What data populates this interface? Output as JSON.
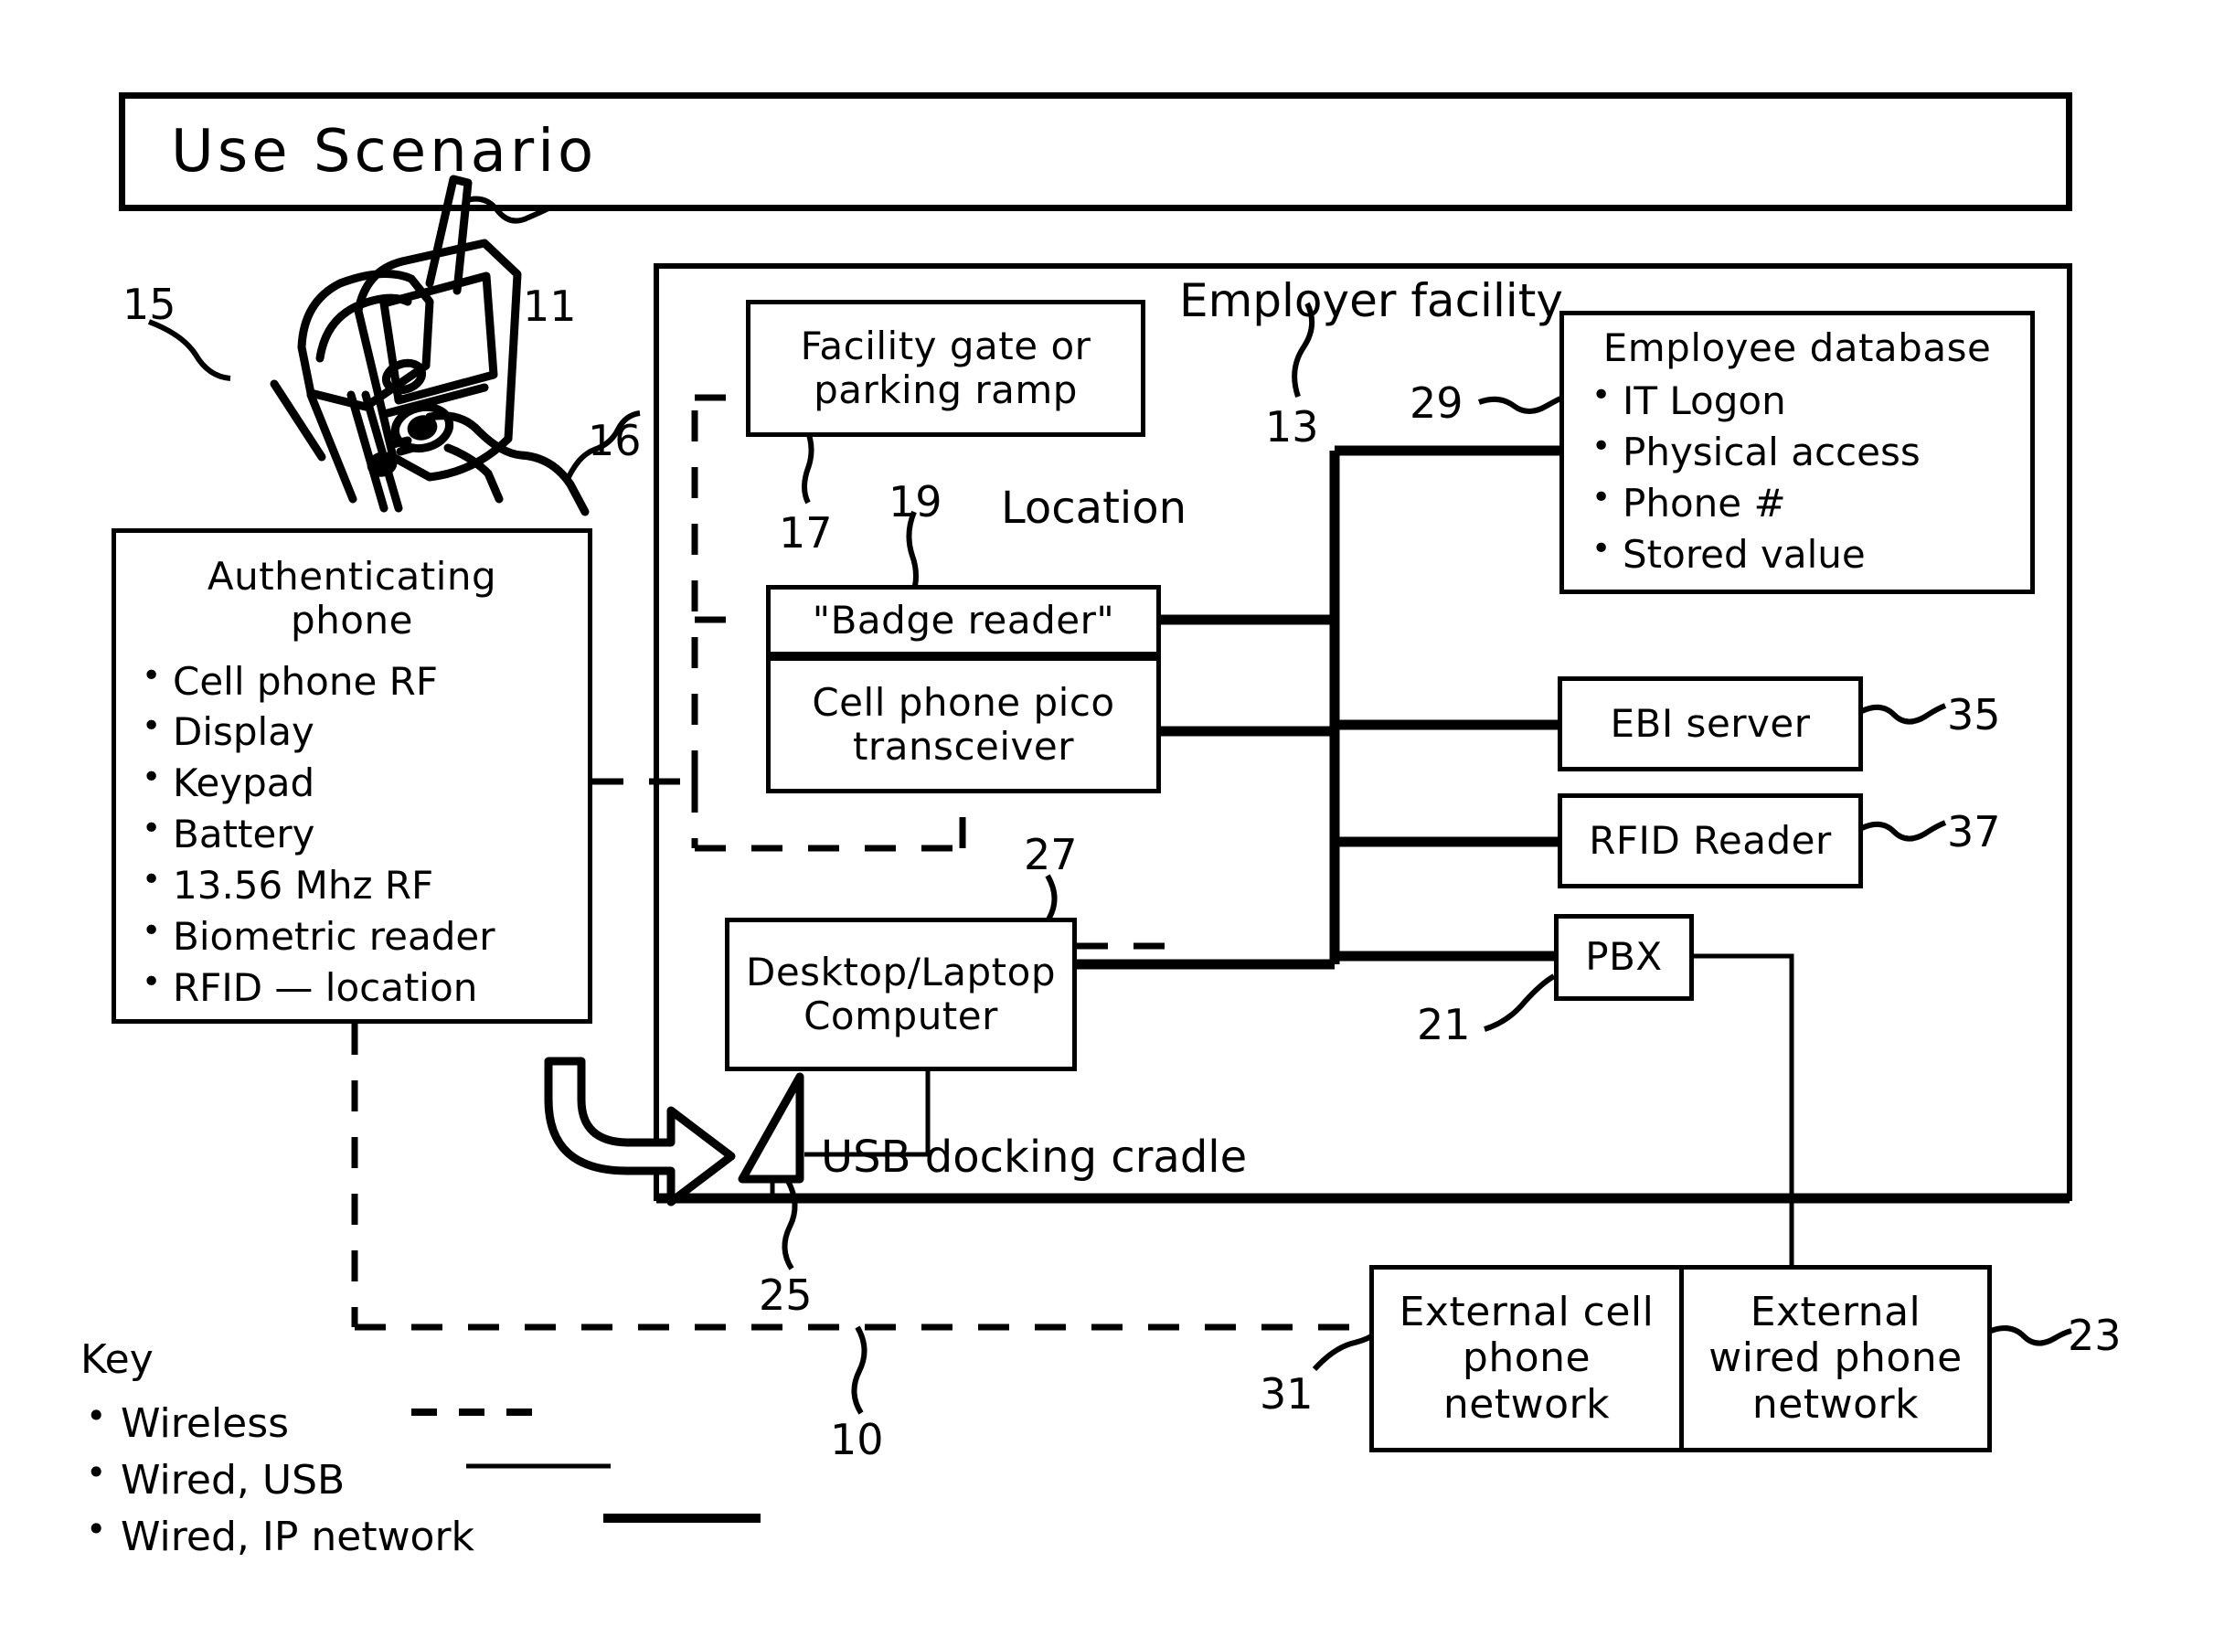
{
  "title": "Use Scenario",
  "figure_label": "10",
  "labels": {
    "employer_facility": "Employer facility",
    "employer_facility_ref": "13",
    "location": "Location",
    "usb_docking_cradle": "USB docking cradle",
    "usb_docking_cradle_ref": "25",
    "phone_ref_antenna": "11",
    "phone_ref_left": "15",
    "phone_ref_hand": "16",
    "auth_phone_ref": "15",
    "facility_gate_ref": "17",
    "badge_reader_ref": "19",
    "computer_ref": "27",
    "employee_db_ref": "29",
    "ebi_server_ref": "35",
    "rfid_reader_ref": "37",
    "pbx_ref": "21",
    "external_cell_ref": "31",
    "external_wired_ref": "23"
  },
  "boxes": {
    "auth_phone": {
      "title": "Authenticating\nphone",
      "items": [
        "Cell phone RF",
        "Display",
        "Keypad",
        "Battery",
        "13.56 Mhz RF",
        "Biometric reader",
        "RFID — location"
      ]
    },
    "facility_gate": {
      "title": "Facility gate or\nparking ramp"
    },
    "badge_reader": {
      "title": "\"Badge reader\""
    },
    "pico_transceiver": {
      "title": "Cell phone pico\ntransceiver"
    },
    "computer": {
      "title": "Desktop/Laptop\nComputer"
    },
    "employee_db": {
      "title": "Employee database",
      "items": [
        "IT Logon",
        "Physical access",
        "Phone #",
        "Stored value"
      ]
    },
    "ebi_server": {
      "title": "EBI server"
    },
    "rfid_reader": {
      "title": "RFID Reader"
    },
    "pbx": {
      "title": "PBX"
    },
    "external_cell_network": {
      "title": "External cell\nphone\nnetwork"
    },
    "external_wired_network": {
      "title": "External\nwired phone\nnetwork"
    }
  },
  "key": {
    "heading": "Key",
    "items": [
      {
        "label": "Wireless",
        "style": "dashed"
      },
      {
        "label": "Wired, USB",
        "style": "thin-solid"
      },
      {
        "label": "Wired, IP network",
        "style": "thick-solid"
      }
    ]
  }
}
